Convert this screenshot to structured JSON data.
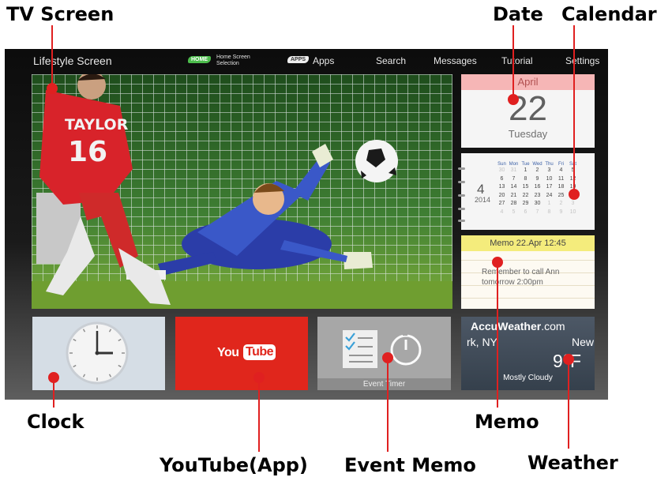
{
  "callouts": {
    "tv_screen": "TV Screen",
    "date": "Date",
    "calendar": "Calendar",
    "clock": "Clock",
    "youtube": "YouTube(App)",
    "event_memo": "Event Memo",
    "memo": "Memo",
    "weather": "Weather"
  },
  "topbar": {
    "title": "Lifestyle Screen",
    "home_badge": "HOME",
    "home_label_line1": "Home Screen",
    "home_label_line2": "Selection",
    "apps_badge": "APPS",
    "apps_label": "Apps",
    "search": "Search",
    "messages": "Messages",
    "tutorial": "Tutorial",
    "settings": "Settings"
  },
  "tv_screen": {
    "player_name": "TAYLOR",
    "player_number": "16"
  },
  "date_tile": {
    "month": "April",
    "day": "22",
    "weekday": "Tuesday"
  },
  "calendar_tile": {
    "month": "4",
    "year": "2014",
    "weekdays": [
      "Sun",
      "Mon",
      "Tue",
      "Wed",
      "Thu",
      "Fri",
      "Sat"
    ],
    "weeks": [
      [
        "30",
        "31",
        "1",
        "2",
        "3",
        "4",
        "5"
      ],
      [
        "6",
        "7",
        "8",
        "9",
        "10",
        "11",
        "12"
      ],
      [
        "13",
        "14",
        "15",
        "16",
        "17",
        "18",
        "19"
      ],
      [
        "20",
        "21",
        "22",
        "23",
        "24",
        "25",
        "26"
      ],
      [
        "27",
        "28",
        "29",
        "30",
        "1",
        "2",
        "3"
      ],
      [
        "4",
        "5",
        "6",
        "7",
        "8",
        "9",
        "10"
      ]
    ]
  },
  "memo_tile": {
    "header": "Memo 22.Apr 12:45",
    "line1": "Remember to call Ann",
    "line2": "tomorrow 2:00pm"
  },
  "youtube_tile": {
    "you": "You",
    "tube": "Tube"
  },
  "event_tile": {
    "label": "Event Timer"
  },
  "weather_tile": {
    "brand": "AccuWeather",
    "brand_suffix": ".com",
    "city_left": "rk, NY",
    "city_right": "New",
    "temp": "9°F",
    "condition": "Mostly Cloudy"
  },
  "colors": {
    "callout_line": "#e02020",
    "home_badge": "#4cbc4c",
    "youtube_red": "#e0261c",
    "date_month_bar": "#f6b6b6",
    "memo_header": "#f4ec7c"
  }
}
